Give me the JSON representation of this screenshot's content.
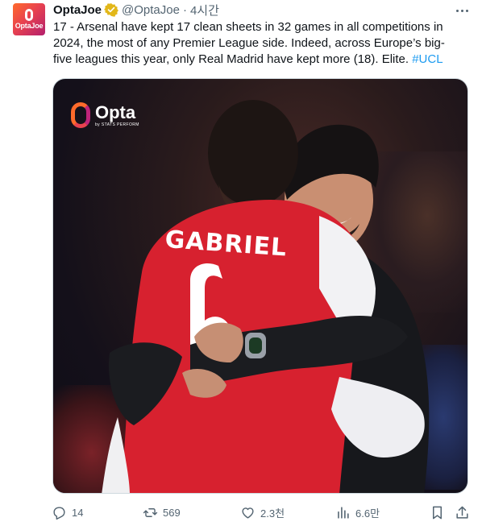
{
  "author": {
    "avatar_text": "OptaJoe",
    "name": "OptaJoe",
    "handle": "@OptaJoe",
    "separator": "·",
    "time": "4시간"
  },
  "tweet": {
    "text": "17 - Arsenal have kept 17 clean sheets in 32 games in all competitions in 2024, the most of any Premier League side. Indeed, across Europe’s big-five leagues this year, only Real Madrid have kept more (18). Elite. ",
    "hashtag": "#UCL"
  },
  "media": {
    "logo_name": "Opta",
    "logo_sub": "by STATS PERFORM",
    "shirt_name": "GABRIEL",
    "shirt_number": "6"
  },
  "actions": {
    "replies": "14",
    "reposts": "569",
    "likes": "2.3천",
    "views": "6.6만"
  },
  "colors": {
    "accent": "#1d9bf0",
    "verified": "#e2b719",
    "muted": "#536471",
    "arsenal_red": "#d7212f"
  },
  "icons": [
    "more-icon",
    "verified-badge-icon",
    "reply-icon",
    "retweet-icon",
    "like-icon",
    "views-icon",
    "bookmark-icon",
    "share-icon"
  ]
}
